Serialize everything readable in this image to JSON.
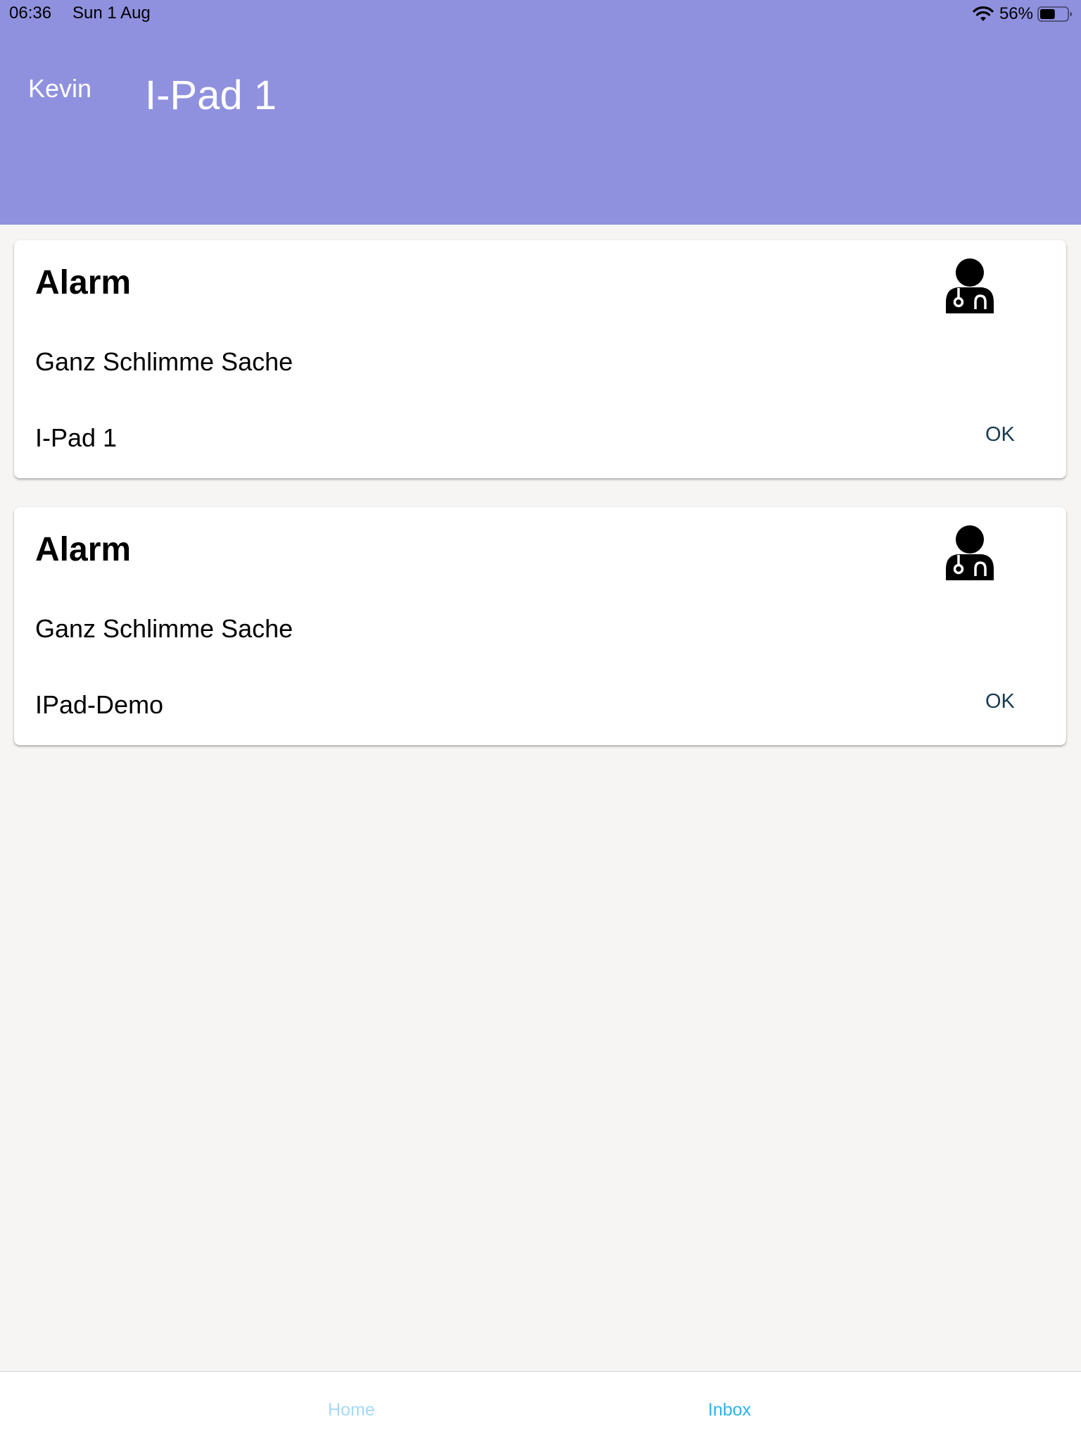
{
  "status_bar": {
    "time": "06:36",
    "date": "Sun 1 Aug",
    "battery_percent": "56%",
    "battery_level": 0.56,
    "wifi_icon": "wifi-icon",
    "battery_icon": "battery-icon"
  },
  "header": {
    "user": "Kevin",
    "title": "I-Pad 1",
    "background_color": "#8f91de"
  },
  "cards": [
    {
      "title": "Alarm",
      "icon": "doctor-icon",
      "message": "Ganz Schlimme Sache",
      "device": "I-Pad 1",
      "action_label": "OK"
    },
    {
      "title": "Alarm",
      "icon": "doctor-icon",
      "message": "Ganz Schlimme Sache",
      "device": "IPad-Demo",
      "action_label": "OK"
    }
  ],
  "tab_bar": {
    "tabs": [
      {
        "label": "Home",
        "active": false
      },
      {
        "label": "Inbox",
        "active": true
      }
    ],
    "active_color": "#2db3ea",
    "inactive_color": "#a5d9f3"
  }
}
